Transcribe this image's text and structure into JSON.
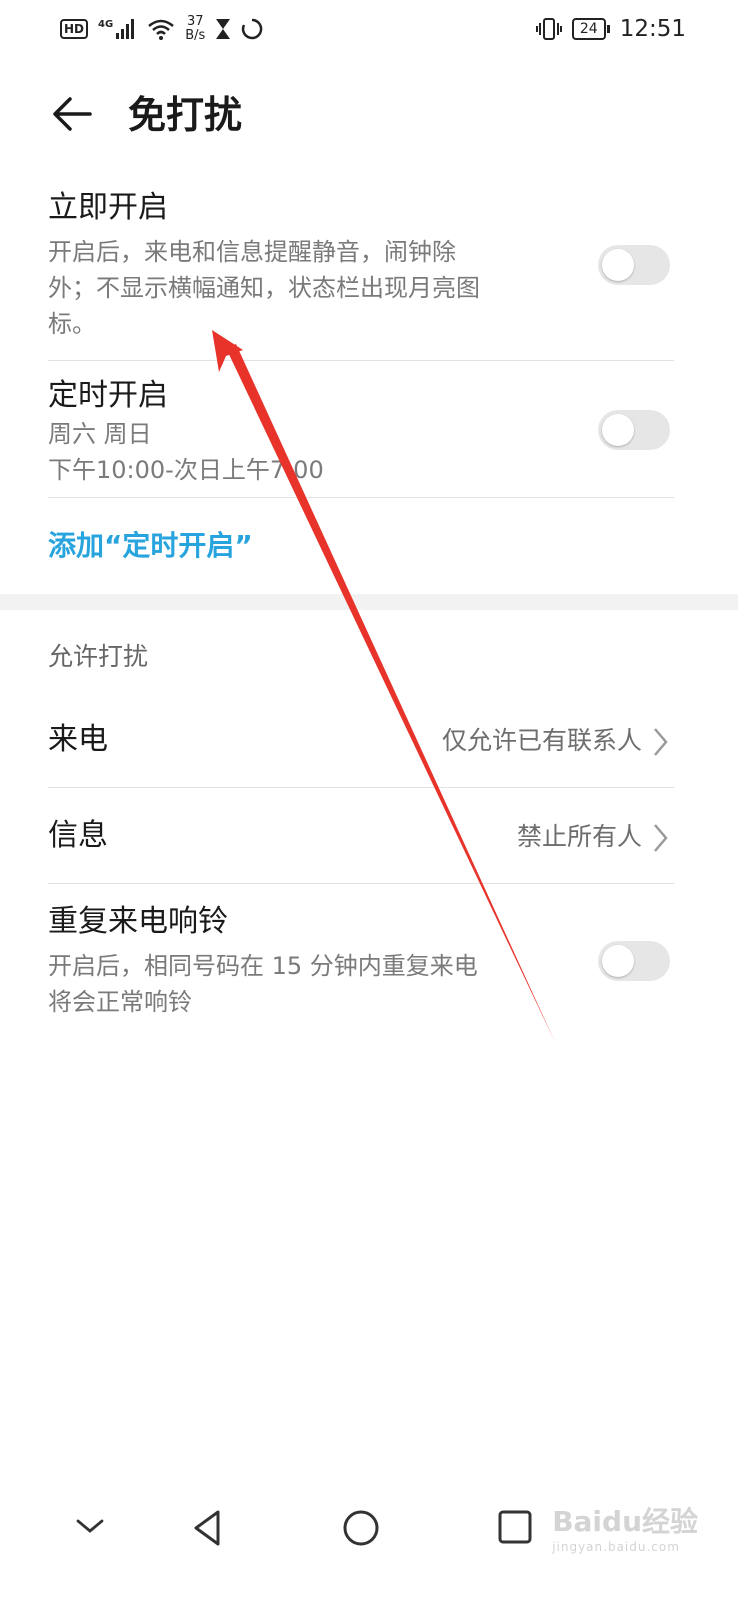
{
  "status_bar": {
    "hd": "HD",
    "network": "4G",
    "speed_value": "37",
    "speed_unit": "B/s",
    "battery": "24",
    "time": "12:51"
  },
  "header": {
    "title": "免打扰"
  },
  "immediate": {
    "title": "立即开启",
    "desc_line1": "开启后，来电和信息提醒静音，闹钟除",
    "desc_line2": "外；不显示横幅通知，状态栏出现月亮图",
    "desc_line3": "标。",
    "enabled": false
  },
  "scheduled": {
    "title": "定时开启",
    "days": "周六 周日",
    "time_range": "下午10:00-次日上午7:00",
    "enabled": false
  },
  "add_schedule_label": "添加“定时开启”",
  "allow_section": {
    "label": "允许打扰",
    "calls": {
      "title": "来电",
      "value": "仅允许已有联系人"
    },
    "messages": {
      "title": "信息",
      "value": "禁止所有人"
    },
    "repeat_calls": {
      "title": "重复来电响铃",
      "desc_line1": "开启后，相同号码在 15 分钟内重复来电",
      "desc_line2": "将会正常响铃",
      "enabled": false
    }
  },
  "nav_bar": {
    "items": [
      "chevron-down-icon",
      "back-triangle-icon",
      "home-circle-icon",
      "recents-square-icon"
    ]
  },
  "watermark": {
    "brand": "Baidu经验",
    "url": "jingyan.baidu.com"
  },
  "colors": {
    "accent_link": "#27a4dd",
    "annotation_arrow": "#e8332a",
    "toggle_off": "#e6e6e6"
  }
}
